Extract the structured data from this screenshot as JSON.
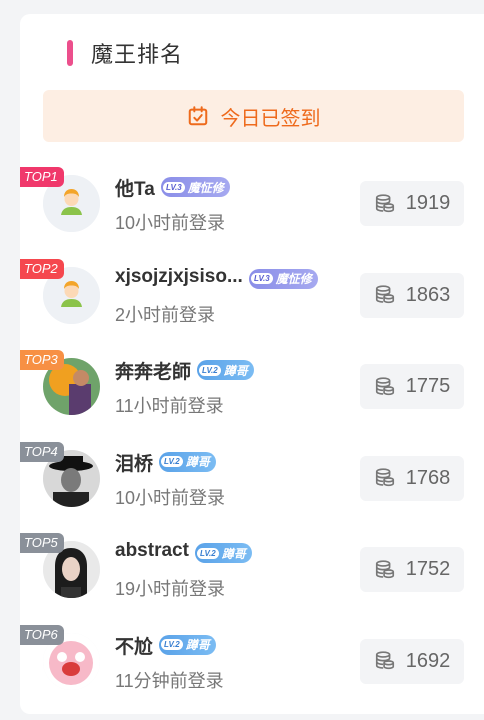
{
  "header": {
    "title": "魔王排名"
  },
  "signin": {
    "label": "今日已签到"
  },
  "ranking": [
    {
      "rank_label": "TOP1",
      "rank_color": "#f0386b",
      "name": "他Ta",
      "level": "LV.3",
      "level_title": "魔怔修",
      "level_class": "lv3",
      "login": "10小时前登录",
      "score": "1919",
      "avatar": "default"
    },
    {
      "rank_label": "TOP2",
      "rank_color": "#f5474e",
      "name": "xjsojzjxjsiso...",
      "level": "LV.3",
      "level_title": "魔怔修",
      "level_class": "lv3",
      "login": "2小时前登录",
      "score": "1863",
      "avatar": "default"
    },
    {
      "rank_label": "TOP3",
      "rank_color": "#f79044",
      "name": "奔奔老師",
      "level": "LV.2",
      "level_title": "蹲哥",
      "level_class": "lv2",
      "login": "11小时前登录",
      "score": "1775",
      "avatar": "photo-orange"
    },
    {
      "rank_label": "TOP4",
      "rank_color": "#8a9099",
      "name": "泪桥",
      "level": "LV.2",
      "level_title": "蹲哥",
      "level_class": "lv2",
      "login": "10小时前登录",
      "score": "1768",
      "avatar": "photo-bw"
    },
    {
      "rank_label": "TOP5",
      "rank_color": "#8a9099",
      "name": "abstract",
      "level": "LV.2",
      "level_title": "蹲哥",
      "level_class": "lv2",
      "login": "19小时前登录",
      "score": "1752",
      "avatar": "photo-dark"
    },
    {
      "rank_label": "TOP6",
      "rank_color": "#8a9099",
      "name": "不尬",
      "level": "LV.2",
      "level_title": "蹲哥",
      "level_class": "lv2",
      "login": "11分钟前登录",
      "score": "1692",
      "avatar": "photo-pink"
    }
  ]
}
